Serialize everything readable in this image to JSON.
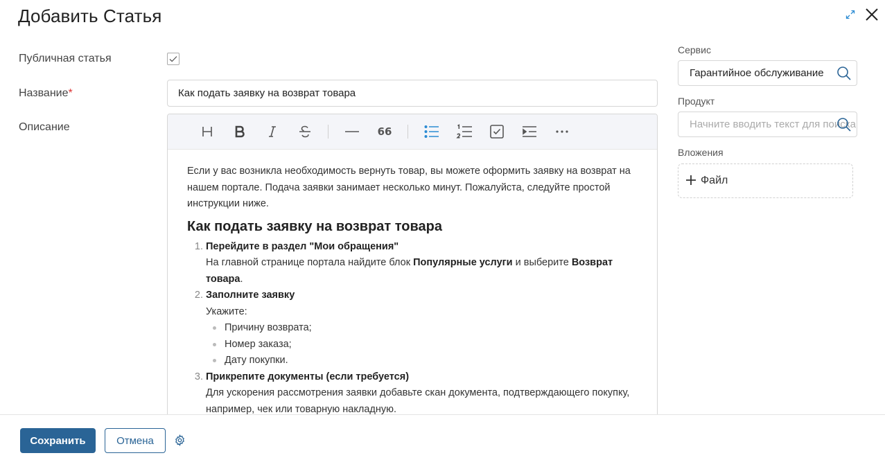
{
  "header": {
    "title": "Добавить Статья",
    "icons": [
      "expand-icon",
      "close-icon"
    ]
  },
  "form": {
    "public_label": "Публичная статья",
    "public_checked": true,
    "name_label": "Название",
    "required_mark": "*",
    "name_value": "Как подать заявку на возврат товара",
    "description_label": "Описание"
  },
  "toolbar": {
    "buttons": [
      "heading",
      "bold",
      "italic",
      "strikethrough",
      "horizontal-rule",
      "quote",
      "bullet-list",
      "ordered-list",
      "checklist",
      "indent",
      "more"
    ],
    "quote_glyph": "66",
    "active": "bullet-list"
  },
  "article": {
    "intro": "Если у вас возникла необходимость вернуть товар, вы можете оформить заявку на возврат на нашем портале. Подача заявки занимает несколько минут. Пожалуйста, следуйте простой инструкции ниже.",
    "heading": "Как подать заявку на возврат товара",
    "steps": [
      {
        "title": "Перейдите в раздел \"Мои обращения\"",
        "text_before": "На главной странице портала найдите блок ",
        "bold1": "Популярные услуги",
        "text_mid": " и выберите ",
        "bold2": "Возврат товара",
        "text_after": "."
      },
      {
        "title": "Заполните заявку",
        "text": "Укажите:",
        "bullets": [
          "Причину возврата;",
          "Номер заказа;",
          "Дату покупки."
        ]
      },
      {
        "title": "Прикрепите документы (если требуется)",
        "text": "Для ускорения рассмотрения заявки добавьте скан документа, подтверждающего покупку, например, чек или товарную накладную."
      }
    ]
  },
  "sidebar": {
    "service_label": "Сервис",
    "service_value": "Гарантийное обслуживание",
    "product_label": "Продукт",
    "product_placeholder": "Начните вводить текст для поиска",
    "attachments_label": "Вложения",
    "file_button": "Файл"
  },
  "footer": {
    "save_label": "Сохранить",
    "cancel_label": "Отмена"
  },
  "colors": {
    "primary": "#2a6496",
    "active_tool": "#2b8bd3",
    "required": "#dd3333"
  }
}
